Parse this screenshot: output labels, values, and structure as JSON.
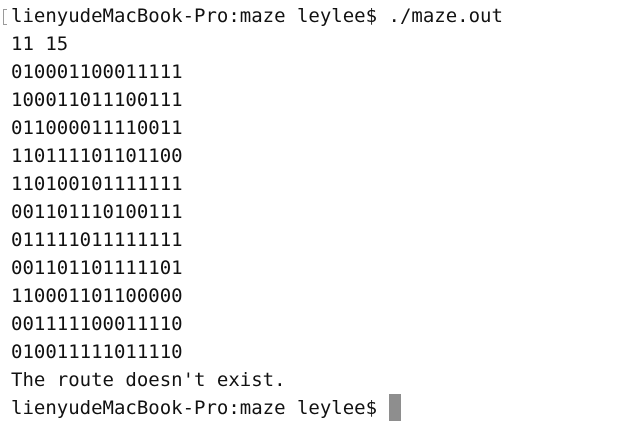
{
  "terminal": {
    "command_line": {
      "prompt": "lienyudeMacBook-Pro:maze leylee$ ",
      "command": "./maze.out"
    },
    "output": [
      "11 15",
      "010001100011111",
      "100011011100111",
      "011000011110011",
      "110111101101100",
      "110100101111111",
      "001101110100111",
      "011111011111111",
      "001101101111101",
      "110001101100000",
      "001111100011110",
      "010011111011110",
      "The route doesn't exist."
    ],
    "final_prompt": "lienyudeMacBook-Pro:maze leylee$ "
  }
}
